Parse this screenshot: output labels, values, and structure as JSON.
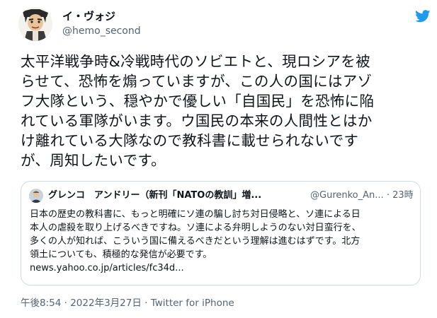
{
  "author": {
    "name": "イ・ヴォジ",
    "handle": "@hemo_second"
  },
  "icons": {
    "platform": "twitter-bird-icon",
    "platform_color": "#1d9bf0"
  },
  "tweet": {
    "lines": [
      "太平洋戦争時&冷戦時代のソビエトと、現ロシアを被",
      "らせて、恐怖を煽っていますが、この人の国にはアゾ",
      "フ大隊という、穏やかで優しい「自国民」を恐怖に陥",
      "れている軍隊がいます。ウ国民の本来の人間性とはか",
      "け離れている大隊なので教科書に載せられないです",
      "が、周知したいです。"
    ]
  },
  "quote": {
    "name": "グレンコ　アンドリー（新刊「NATOの教訓」増...",
    "handle": "@Gurenko_An...",
    "separator": "·",
    "time": "23時間",
    "lines": [
      "日本の歴史の教科書に、もっと明確にソ連の騙し討ち対日侵略と、ソ連による日",
      "本人の虐殺を取り上げるべきですね。ソ連による弁明しようのない対日蛮行を、",
      "多くの人が知れば、こういう国に備えるべきだという理解は進むはずです。北方",
      "領土についても、積極的な発信が必要です。"
    ],
    "link": "news.yahoo.co.jp/articles/fc34d..."
  },
  "footer": {
    "time": "午後8:54",
    "sep1": "·",
    "date": "2022年3月27日",
    "sep2": "·",
    "client": "Twitter for iPhone"
  }
}
